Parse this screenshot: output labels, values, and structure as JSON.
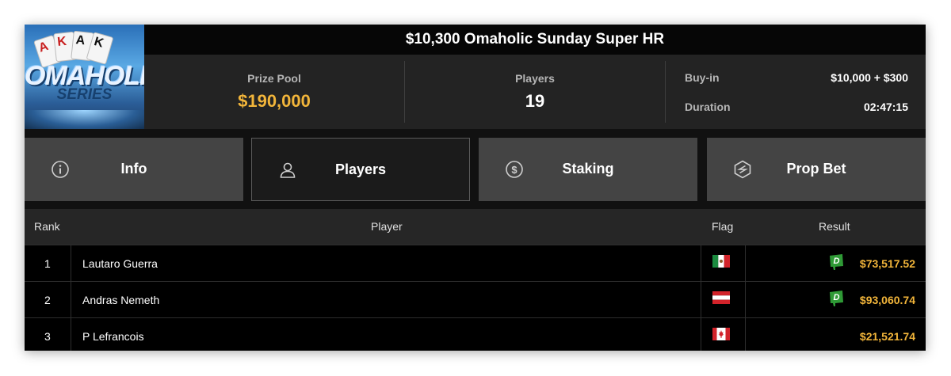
{
  "logo": {
    "cards": [
      "A",
      "K",
      "A",
      "K"
    ],
    "brand": "OMAHOLIC",
    "series": "SERIES"
  },
  "tournament": {
    "title": "$10,300 Omaholic Sunday Super HR"
  },
  "stats": {
    "prize_pool_label": "Prize Pool",
    "prize_pool_value": "$190,000",
    "players_label": "Players",
    "players_value": "19",
    "buyin_label": "Buy-in",
    "buyin_value": "$10,000 + $300",
    "duration_label": "Duration",
    "duration_value": "02:47:15"
  },
  "tabs": [
    {
      "label": "Info",
      "icon": "info-icon",
      "active": false
    },
    {
      "label": "Players",
      "icon": "user-icon",
      "active": true
    },
    {
      "label": "Staking",
      "icon": "dollar-coin-icon",
      "active": false
    },
    {
      "label": "Prop Bet",
      "icon": "prop-bet-icon",
      "active": false
    }
  ],
  "table": {
    "headers": {
      "rank": "Rank",
      "player": "Player",
      "flag": "Flag",
      "result": "Result"
    },
    "rows": [
      {
        "rank": "1",
        "player": "Lautaro Guerra",
        "flag": "mexico",
        "result": "$73,517.52",
        "badge": "D"
      },
      {
        "rank": "2",
        "player": "Andras Nemeth",
        "flag": "austria",
        "result": "$93,060.74",
        "badge": "D"
      },
      {
        "rank": "3",
        "player": "P Lefrancois",
        "flag": "canada",
        "result": "$21,521.74",
        "badge": ""
      }
    ]
  },
  "colors": {
    "accent_gold": "#f2b53a",
    "badge_green": "#2f9a36"
  }
}
